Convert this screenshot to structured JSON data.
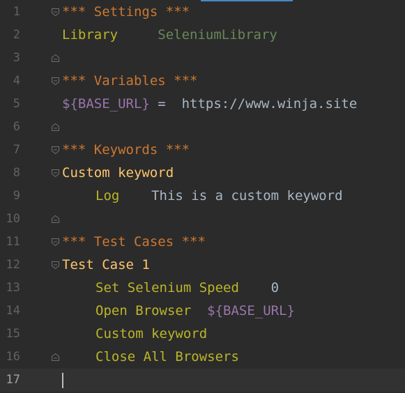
{
  "editor": {
    "lines": [
      {
        "num": "1",
        "fold": "open",
        "tokens": [
          {
            "cls": "section",
            "text": "*** Settings ***"
          }
        ]
      },
      {
        "num": "2",
        "fold": "none",
        "tokens": [
          {
            "cls": "setting",
            "text": "Library"
          },
          {
            "cls": "plain",
            "text": "     "
          },
          {
            "cls": "libname",
            "text": "SeleniumLibrary"
          }
        ]
      },
      {
        "num": "3",
        "fold": "close",
        "tokens": []
      },
      {
        "num": "4",
        "fold": "open",
        "tokens": [
          {
            "cls": "section",
            "text": "*** Variables ***"
          }
        ]
      },
      {
        "num": "5",
        "fold": "none",
        "tokens": [
          {
            "cls": "var",
            "text": "${BASE_URL}"
          },
          {
            "cls": "plain",
            "text": " =  https://www.winja.site"
          }
        ]
      },
      {
        "num": "6",
        "fold": "close",
        "tokens": []
      },
      {
        "num": "7",
        "fold": "open",
        "tokens": [
          {
            "cls": "section",
            "text": "*** Keywords ***"
          }
        ]
      },
      {
        "num": "8",
        "fold": "open",
        "tokens": [
          {
            "cls": "kw-def",
            "text": "Custom keyword"
          }
        ]
      },
      {
        "num": "9",
        "fold": "none",
        "indent": true,
        "tokens": [
          {
            "cls": "call",
            "text": "Log"
          },
          {
            "cls": "plain",
            "text": "    This is a custom keyword"
          }
        ]
      },
      {
        "num": "10",
        "fold": "close",
        "tokens": []
      },
      {
        "num": "11",
        "fold": "open",
        "tokens": [
          {
            "cls": "section",
            "text": "*** Test Cases ***"
          }
        ]
      },
      {
        "num": "12",
        "fold": "open",
        "tokens": [
          {
            "cls": "kw-def",
            "text": "Test Case 1"
          }
        ]
      },
      {
        "num": "13",
        "fold": "none",
        "indent": true,
        "tokens": [
          {
            "cls": "call",
            "text": "Set Selenium Speed"
          },
          {
            "cls": "plain",
            "text": "    0"
          }
        ]
      },
      {
        "num": "14",
        "fold": "none",
        "indent": true,
        "tokens": [
          {
            "cls": "call",
            "text": "Open Browser"
          },
          {
            "cls": "plain",
            "text": "  "
          },
          {
            "cls": "var",
            "text": "${BASE_URL}"
          }
        ]
      },
      {
        "num": "15",
        "fold": "none",
        "indent": true,
        "tokens": [
          {
            "cls": "call",
            "text": "Custom keyword"
          }
        ]
      },
      {
        "num": "16",
        "fold": "close",
        "indent": true,
        "tokens": [
          {
            "cls": "call",
            "text": "Close All Browsers"
          }
        ]
      },
      {
        "num": "17",
        "fold": "none",
        "current": true,
        "tokens": []
      }
    ]
  },
  "colors": {
    "background": "#2b2b2b",
    "current_line": "#323232",
    "section": "#cc7832",
    "keyword_definition": "#ffc66d",
    "keyword_call": "#bbb529",
    "library_name": "#6a8759",
    "variable": "#9876aa",
    "plain_text": "#a9b7c6",
    "line_number": "#606366",
    "accent": "#4a88c7"
  },
  "icons": {
    "fold_open": "fold-open-icon",
    "fold_close": "fold-close-icon"
  }
}
